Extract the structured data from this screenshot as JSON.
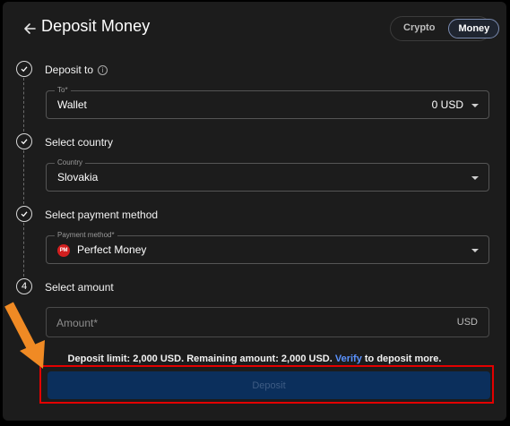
{
  "header": {
    "title": "Deposit Money",
    "toggle": {
      "options": [
        "Crypto",
        "Money"
      ],
      "selected": "Money"
    }
  },
  "steps": [
    {
      "marker": "check",
      "label": "Deposit to",
      "has_info": true,
      "field": {
        "legend": "To*",
        "value": "Wallet",
        "right_value": "0 USD"
      }
    },
    {
      "marker": "check",
      "label": "Select country",
      "field": {
        "legend": "Country",
        "value": "Slovakia"
      }
    },
    {
      "marker": "check",
      "label": "Select payment method",
      "field": {
        "legend": "Payment method*",
        "value": "Perfect Money",
        "logo_text": "PM"
      }
    },
    {
      "marker": "4",
      "label": "Select amount",
      "field": {
        "placeholder": "Amount*",
        "unit": "USD"
      }
    }
  ],
  "limit": {
    "text_before": "Deposit limit: 2,000 USD. Remaining amount: 2,000 USD.",
    "link": "Verify",
    "text_after": "to deposit more."
  },
  "deposit_button": {
    "label": "Deposit",
    "disabled": true
  },
  "colors": {
    "panel_bg": "#1c1c1c",
    "accent_link": "#5b93ff",
    "button_bg": "#0b2f5c",
    "annotation_red": "#e30000",
    "annotation_arrow": "#f08a24"
  }
}
